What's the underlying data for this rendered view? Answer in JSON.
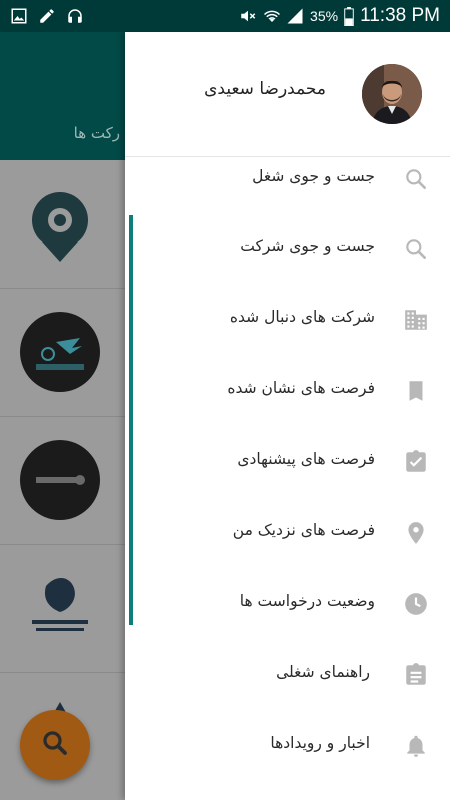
{
  "status_bar": {
    "battery_percent": "35%",
    "time": "11:38 PM",
    "icons": [
      "image-icon",
      "pencil-icon",
      "headset-icon",
      "mute-icon",
      "wifi-icon",
      "signal-icon",
      "battery-icon"
    ]
  },
  "background": {
    "header_title_partial": "رکت ها",
    "fab_icon": "search-icon"
  },
  "drawer": {
    "user_name": "محمدرضا سعیدی",
    "items": [
      {
        "label": "جست و جوی شغل",
        "icon": "search-icon"
      },
      {
        "label": "جست و جوی شرکت",
        "icon": "search-icon"
      },
      {
        "label": "شرکت های دنبال شده",
        "icon": "building-icon"
      },
      {
        "label": "فرصت های نشان شده",
        "icon": "bookmark-icon"
      },
      {
        "label": "فرصت های پیشنهادی",
        "icon": "assignment-turned-in-icon"
      },
      {
        "label": "فرصت های نزدیک من",
        "icon": "location-pin-icon"
      },
      {
        "label": "وضعیت درخواست ها",
        "icon": "clock-icon"
      },
      {
        "label": "راهنمای شغلی",
        "icon": "clipboard-icon"
      },
      {
        "label": "اخبار و رویدادها",
        "icon": "bell-icon"
      }
    ]
  },
  "colors": {
    "status_bar": "#003a38",
    "header": "#024a48",
    "accent": "#0f7e7b",
    "fab": "#a05a14",
    "icon_grey": "#b8b8b8"
  }
}
